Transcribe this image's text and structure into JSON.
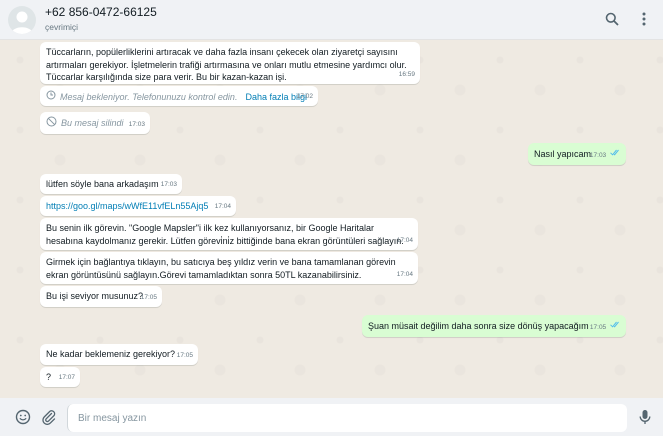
{
  "header": {
    "contact_name": "+62 856-0472-66125",
    "status": "çevrimiçi"
  },
  "messages": [
    {
      "text": "Tüccarların, popülerliklerini artıracak ve daha fazla insanı çekecek olan ziyaretçi sayısını artırmaları gerekiyor. İşletmelerin trafiği artırmasına ve onları mutlu etmesine yardımcı olur. Tüccarlar karşılığında size para verir. Bu bir kazan-kazan işi.",
      "time": "16:59"
    },
    {
      "text": "Mesaj bekleniyor. Telefonunuzu kontrol edin.",
      "link": "Daha fazla bilgi",
      "time": "17:02"
    },
    {
      "text": "Bu mesaj silindi",
      "time": "17:03"
    },
    {
      "text": "Nasıl yapıcam",
      "time": "17:03"
    },
    {
      "text": "lütfen söyle bana arkadaşım",
      "time": "17:03"
    },
    {
      "text": "https://goo.gl/maps/wWfE11vfELn55Ajq5",
      "time": "17:04"
    },
    {
      "text": "Bu senin ilk görevin. \"Google Mapsler\"i ilk kez kullanıyorsanız, bir Google Haritalar hesabına kaydolmanız gerekir. Lütfen görevi̇ni̇z bittiğinde bana ekran görüntüleri sağlayın.",
      "time": "17:04"
    },
    {
      "text": "Girmek için bağlantıya tıklayın, bu satıcıya beş yıldız verin ve bana tamamlanan görevin ekran görüntüsünü sağlayın.Görevi tamamladıktan sonra 50TL kazanabilirsiniz.",
      "time": "17:04"
    },
    {
      "text": "Bu işi seviyor musunuz?",
      "time": "17:05"
    },
    {
      "text": "Şuan müsait değilim daha sonra size dönüş yapacağım",
      "time": "17:05"
    },
    {
      "text": "Ne kadar beklemeniz gerekiyor?",
      "time": "17:05"
    },
    {
      "text": "?",
      "time": "17:07"
    }
  ],
  "composer": {
    "placeholder": "Bir mesaj yazın"
  },
  "colors": {
    "header_bg": "#f0f2f5",
    "chat_bg": "#efeae2",
    "incoming_bubble": "#ffffff",
    "outgoing_bubble": "#d9fdd3",
    "read_ticks": "#53bdeb",
    "link": "#027eb5"
  },
  "icons": {
    "header": [
      "search-icon",
      "menu-icon"
    ],
    "footer": [
      "emoji-icon",
      "attach-icon",
      "mic-icon"
    ],
    "status": [
      "clock-icon",
      "deleted-icon",
      "double-check-icon"
    ]
  }
}
